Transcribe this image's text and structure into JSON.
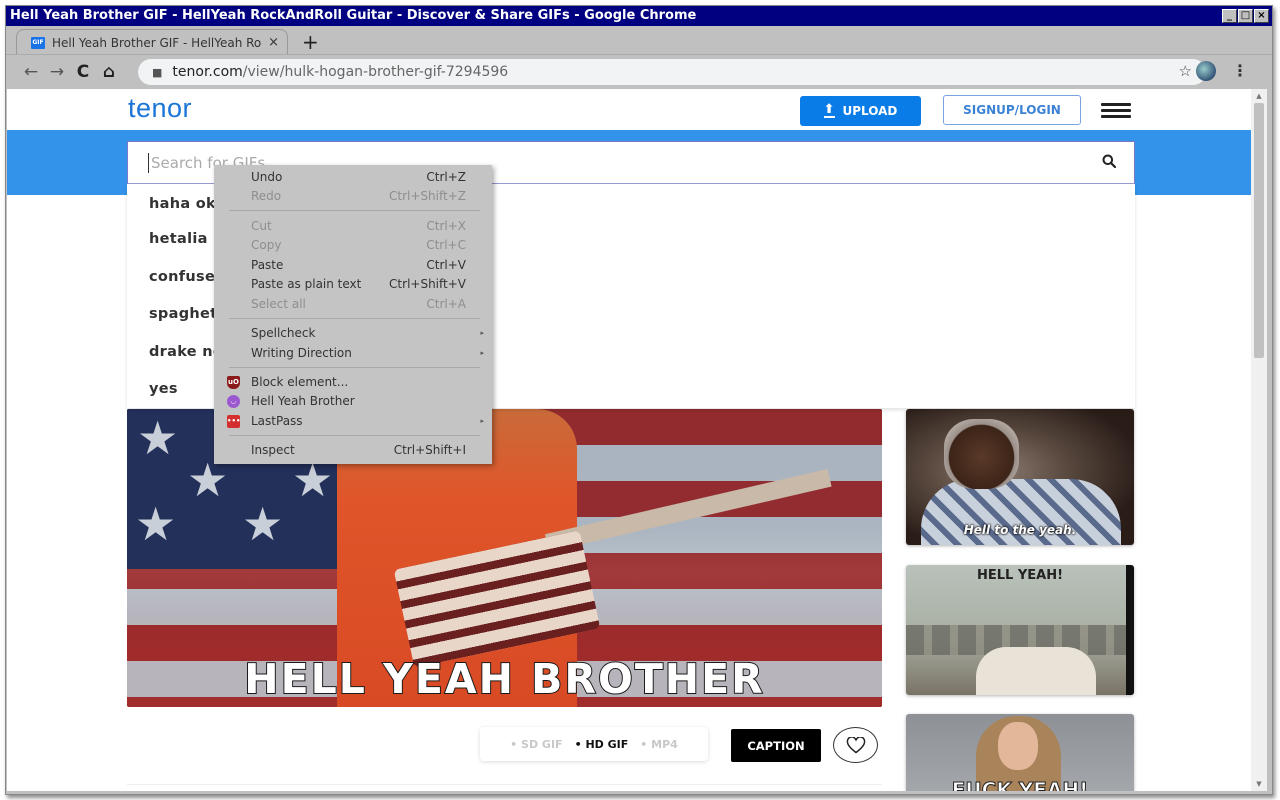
{
  "window": {
    "title": "Hell Yeah Brother GIF - HellYeah RockAndRoll Guitar - Discover & Share GIFs - Google Chrome",
    "controls": [
      "_",
      "□",
      "×"
    ]
  },
  "browser": {
    "tab": {
      "favicon": "GIF",
      "title": "Hell Yeah Brother GIF - HellYeah RockAndRoll Guitar",
      "close": "×"
    },
    "new_tab": "+",
    "nav": {
      "back": "←",
      "forward": "→",
      "reload": "C",
      "home": "⌂"
    },
    "url": {
      "lock": "🔒",
      "host": "tenor.com",
      "path": "/view/hulk-hogan-brother-gif-7294596"
    },
    "bookmark_star": "☆",
    "menu": "⋮"
  },
  "site": {
    "logo": "tenor",
    "upload_label": "UPLOAD",
    "upload_icon": "⬆",
    "signup_label": "SIGNUP/LOGIN",
    "brand_color": "#1b75d8",
    "band_color": "#3392ea",
    "search": {
      "placeholder": "Search for GIFs",
      "value": ""
    },
    "suggestions": [
      "haha ok",
      "hetalia",
      "confused",
      "spaghetti",
      "drake no",
      "yes"
    ]
  },
  "main_gif": {
    "caption": "HELL YEAH BROTHER",
    "formats": [
      {
        "label": "SD GIF",
        "active": false
      },
      {
        "label": "HD GIF",
        "active": true
      },
      {
        "label": "MP4",
        "active": false
      }
    ],
    "caption_button": "CAPTION"
  },
  "related": [
    {
      "text": "Hell to the yeah."
    },
    {
      "text": "HELL YEAH!"
    },
    {
      "text": "FUCK YEAH!"
    }
  ],
  "context_menu": {
    "items": [
      {
        "label": "Undo",
        "shortcut": "Ctrl+Z",
        "disabled": false
      },
      {
        "label": "Redo",
        "shortcut": "Ctrl+Shift+Z",
        "disabled": true
      },
      {
        "label": "Cut",
        "shortcut": "Ctrl+X",
        "disabled": true
      },
      {
        "label": "Copy",
        "shortcut": "Ctrl+C",
        "disabled": true
      },
      {
        "label": "Paste",
        "shortcut": "Ctrl+V",
        "disabled": false
      },
      {
        "label": "Paste as plain text",
        "shortcut": "Ctrl+Shift+V",
        "disabled": false
      },
      {
        "label": "Select all",
        "shortcut": "Ctrl+A",
        "disabled": true
      },
      {
        "label": "Spellcheck",
        "submenu": true
      },
      {
        "label": "Writing Direction",
        "submenu": true
      },
      {
        "label": "Block element...",
        "icon": "uBlock"
      },
      {
        "label": "Hell Yeah Brother",
        "icon": "devil"
      },
      {
        "label": "LastPass",
        "icon": "lastpass",
        "submenu": true
      },
      {
        "label": "Inspect",
        "shortcut": "Ctrl+Shift+I",
        "disabled": false
      }
    ],
    "submenu_arrow": "▸"
  }
}
